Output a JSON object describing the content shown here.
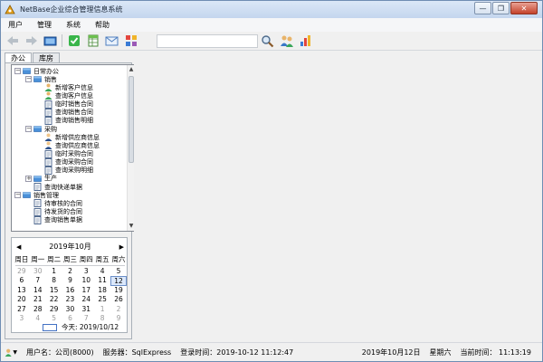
{
  "window": {
    "title": "NetBase企业综合管理信息系统"
  },
  "menu": [
    "用户",
    "管理",
    "系统",
    "帮助"
  ],
  "toolbar": {
    "search_value": ""
  },
  "tabs": [
    "办公",
    "库房"
  ],
  "tree": [
    {
      "level": 0,
      "label": "日常办公",
      "expander": "−",
      "icon": "folder"
    },
    {
      "level": 1,
      "label": "销售",
      "expander": "−",
      "icon": "folder"
    },
    {
      "level": 2,
      "label": "新增客户信息",
      "icon": "user"
    },
    {
      "level": 2,
      "label": "查询客户信息",
      "icon": "user"
    },
    {
      "level": 2,
      "label": "临时销售合同",
      "icon": "doc"
    },
    {
      "level": 2,
      "label": "查询销售合同",
      "icon": "doc"
    },
    {
      "level": 2,
      "label": "查询销售明细",
      "icon": "doc"
    },
    {
      "level": 1,
      "label": "采购",
      "expander": "−",
      "icon": "folder"
    },
    {
      "level": 2,
      "label": "新增供应商信息",
      "icon": "person"
    },
    {
      "level": 2,
      "label": "查询供应商信息",
      "icon": "person"
    },
    {
      "level": 2,
      "label": "临时采购合同",
      "icon": "doc"
    },
    {
      "level": 2,
      "label": "查询采购合同",
      "icon": "doc"
    },
    {
      "level": 2,
      "label": "查询采购明细",
      "icon": "doc"
    },
    {
      "level": 1,
      "label": "生产",
      "expander": "+",
      "icon": "folder"
    },
    {
      "level": 1,
      "label": "查询快递单据",
      "icon": "doc"
    },
    {
      "level": 0,
      "label": "销售管理",
      "expander": "−",
      "icon": "folder"
    },
    {
      "level": 1,
      "label": "待审核的合同",
      "icon": "doc"
    },
    {
      "level": 1,
      "label": "待发货的合同",
      "icon": "doc"
    },
    {
      "level": 1,
      "label": "查询销售单据",
      "icon": "doc"
    }
  ],
  "calendar": {
    "month_label": "2019年10月",
    "weekdays": [
      "周日",
      "周一",
      "周二",
      "周三",
      "周四",
      "周五",
      "周六"
    ],
    "weeks": [
      [
        "29",
        "30",
        "1",
        "2",
        "3",
        "4",
        "5"
      ],
      [
        "6",
        "7",
        "8",
        "9",
        "10",
        "11",
        "12"
      ],
      [
        "13",
        "14",
        "15",
        "16",
        "17",
        "18",
        "19"
      ],
      [
        "20",
        "21",
        "22",
        "23",
        "24",
        "25",
        "26"
      ],
      [
        "27",
        "28",
        "29",
        "30",
        "31",
        "1",
        "2"
      ],
      [
        "3",
        "4",
        "5",
        "6",
        "7",
        "8",
        "9"
      ]
    ],
    "selected": "12",
    "today_label": "今天: 2019/10/12"
  },
  "status": {
    "user": "用户名：公司(8000)",
    "server": "服务器：SqlExpress",
    "login": "登录时间：2019-10-12 11:12:47",
    "date": "2019年10月12日",
    "weekday": "星期六",
    "clock": "当前时间：  11:13:19"
  }
}
